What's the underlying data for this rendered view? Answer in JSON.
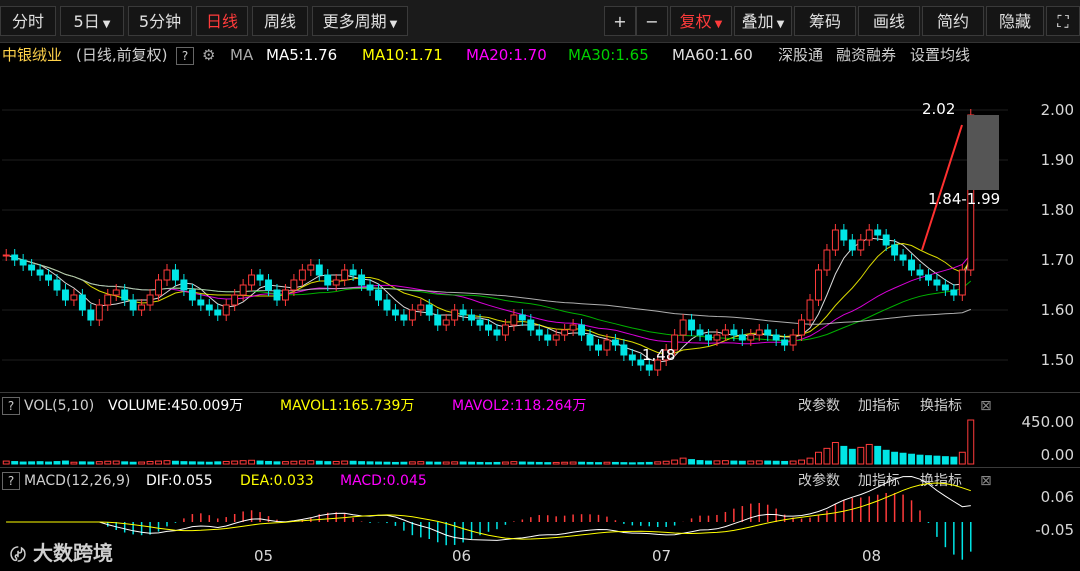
{
  "toolbar": {
    "items": [
      "分时",
      "5日",
      "5分钟",
      "日线",
      "周线",
      "更多周期",
      "+",
      "−",
      "复权",
      "叠加",
      "筹码",
      "画线",
      "简约",
      "隐藏",
      "⛶"
    ],
    "active": "日线"
  },
  "legend": {
    "stock": "中银绒业",
    "mode": "(日线,前复权)",
    "q": "?",
    "ma_label": "MA",
    "ma5": "MA5:1.76",
    "ma10": "MA10:1.71",
    "ma20": "MA20:1.70",
    "ma30": "MA30:1.65",
    "ma60": "MA60:1.60",
    "link1": "深股通",
    "link2": "融资融券",
    "link3": "设置均线"
  },
  "vol_legend": {
    "q": "?",
    "name": "VOL(5,10)",
    "volume": "VOLUME:450.009万",
    "mavol1": "MAVOL1:165.739万",
    "mavol2": "MAVOL2:118.264万",
    "btn1": "改参数",
    "btn2": "加指标",
    "btn3": "换指标"
  },
  "macd_legend": {
    "q": "?",
    "name": "MACD(12,26,9)",
    "dif": "DIF:0.055",
    "dea": "DEA:0.033",
    "macd": "MACD:0.045",
    "btn1": "改参数",
    "btn2": "加指标",
    "btn3": "换指标"
  },
  "annotations": {
    "high": "2.02",
    "range": "1.84-1.99",
    "low": "1.48"
  },
  "watermark": "大数跨境",
  "colors": {
    "up": "#ff3b3b",
    "down": "#00e5e5",
    "ma5": "#ffffff",
    "ma10": "#ffff00",
    "ma20": "#ff00ff",
    "ma30": "#00d000",
    "ma60": "#cccccc"
  },
  "chart_data": [
    {
      "type": "candlestick",
      "title": "中银绒业 (日线,前复权)",
      "y_ticks": [
        "2.00",
        "1.90",
        "1.80",
        "1.70",
        "1.60",
        "1.50"
      ],
      "ylim": [
        1.45,
        2.05
      ],
      "x_ticks": [
        "05",
        "06",
        "07",
        "08"
      ],
      "ma_values": {
        "MA5": 1.76,
        "MA10": 1.71,
        "MA20": 1.7,
        "MA30": 1.65,
        "MA60": 1.6
      },
      "close": [
        1.71,
        1.7,
        1.69,
        1.68,
        1.67,
        1.66,
        1.64,
        1.62,
        1.63,
        1.6,
        1.58,
        1.61,
        1.63,
        1.64,
        1.62,
        1.6,
        1.61,
        1.63,
        1.66,
        1.68,
        1.66,
        1.64,
        1.62,
        1.61,
        1.6,
        1.59,
        1.61,
        1.63,
        1.65,
        1.67,
        1.66,
        1.64,
        1.62,
        1.64,
        1.66,
        1.68,
        1.69,
        1.67,
        1.65,
        1.66,
        1.68,
        1.67,
        1.65,
        1.64,
        1.62,
        1.6,
        1.59,
        1.58,
        1.6,
        1.61,
        1.59,
        1.57,
        1.58,
        1.6,
        1.59,
        1.58,
        1.57,
        1.56,
        1.55,
        1.57,
        1.59,
        1.58,
        1.56,
        1.55,
        1.54,
        1.55,
        1.56,
        1.57,
        1.55,
        1.53,
        1.52,
        1.54,
        1.53,
        1.51,
        1.5,
        1.49,
        1.48,
        1.5,
        1.52,
        1.55,
        1.58,
        1.56,
        1.55,
        1.54,
        1.55,
        1.56,
        1.55,
        1.54,
        1.55,
        1.56,
        1.55,
        1.54,
        1.53,
        1.55,
        1.58,
        1.62,
        1.68,
        1.72,
        1.76,
        1.74,
        1.72,
        1.74,
        1.76,
        1.75,
        1.73,
        1.71,
        1.7,
        1.68,
        1.67,
        1.66,
        1.65,
        1.64,
        1.63,
        1.68,
        1.99
      ]
    },
    {
      "type": "bar",
      "title": "VOL(5,10)",
      "y_ticks": [
        "450.00",
        "0.00"
      ],
      "values": [
        30,
        25,
        20,
        22,
        24,
        20,
        25,
        30,
        18,
        22,
        20,
        24,
        28,
        30,
        22,
        18,
        20,
        26,
        30,
        34,
        28,
        24,
        22,
        20,
        18,
        22,
        26,
        30,
        34,
        38,
        30,
        26,
        22,
        24,
        28,
        32,
        34,
        28,
        24,
        26,
        30,
        28,
        24,
        22,
        20,
        18,
        16,
        18,
        22,
        24,
        20,
        18,
        20,
        22,
        20,
        18,
        16,
        14,
        16,
        20,
        24,
        20,
        18,
        16,
        14,
        16,
        18,
        20,
        18,
        16,
        14,
        18,
        16,
        14,
        12,
        14,
        16,
        22,
        28,
        40,
        60,
        45,
        35,
        30,
        32,
        34,
        30,
        28,
        30,
        32,
        30,
        28,
        26,
        30,
        40,
        60,
        120,
        160,
        220,
        180,
        150,
        170,
        200,
        180,
        140,
        120,
        110,
        100,
        90,
        85,
        80,
        75,
        70,
        120,
        450
      ]
    },
    {
      "type": "bar",
      "title": "MACD(12,26,9)",
      "y_ticks": [
        "0.06",
        "-0.05"
      ],
      "dif_value": 0.055,
      "dea_value": 0.033,
      "macd_value": 0.045
    }
  ]
}
